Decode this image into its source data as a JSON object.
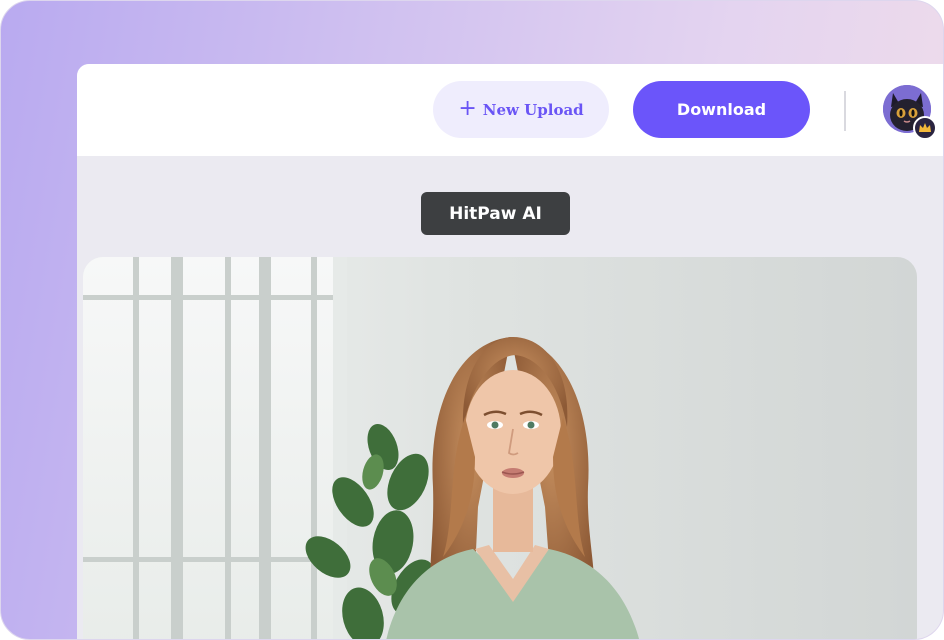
{
  "toolbar": {
    "new_upload_label": "New Upload",
    "download_label": "Download"
  },
  "preview": {
    "label": "HitPaw AI"
  },
  "colors": {
    "accent": "#6b55fa",
    "accent_soft": "#efedfd",
    "chip_bg": "#3d3f41",
    "canvas_bg": "#ebeaf1"
  },
  "icons": {
    "upload": "plus-icon",
    "avatar": "cat-avatar-icon",
    "badge": "crown-icon"
  }
}
